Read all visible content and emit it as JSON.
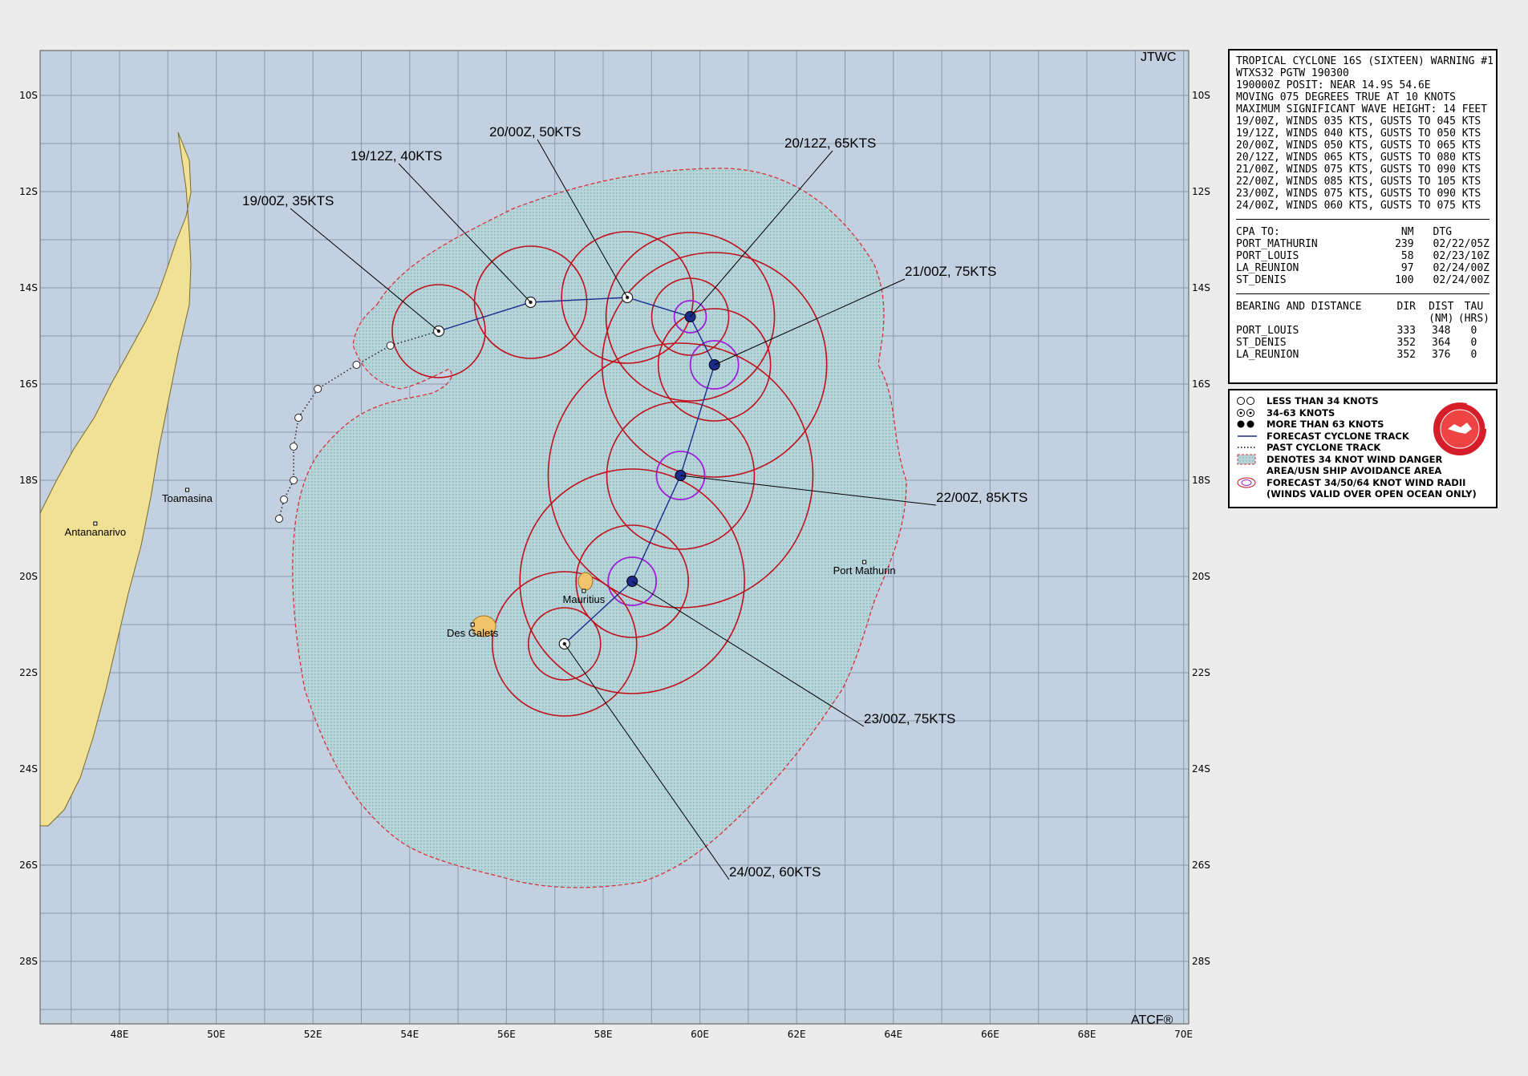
{
  "agency": "JTWC",
  "footer": "ATCF®",
  "colors": {
    "ocean": "#c2d0e0",
    "land": "#f1e194",
    "danger_area": "#aecfd6",
    "wind_radii": "#c0101b",
    "wind_radii_inner": "#a01fd8",
    "track": "#1b2a8c"
  },
  "axes": {
    "lon_labels": [
      "48E",
      "50E",
      "52E",
      "54E",
      "56E",
      "58E",
      "60E",
      "62E",
      "64E",
      "66E",
      "68E",
      "70E"
    ],
    "lat_labels": [
      "10S",
      "12S",
      "14S",
      "16S",
      "18S",
      "20S",
      "22S",
      "24S",
      "26S",
      "28S"
    ]
  },
  "places": [
    {
      "name": "Toamasina",
      "lon": 49.4,
      "lat": -18.2
    },
    {
      "name": "Antananarivo",
      "lon": 47.5,
      "lat": -18.9
    },
    {
      "name": "Mauritius",
      "lon": 57.6,
      "lat": -20.3
    },
    {
      "name": "Des Galets",
      "lon": 55.3,
      "lat": -21.0
    },
    {
      "name": "Port Mathurin",
      "lon": 63.4,
      "lat": -19.7
    }
  ],
  "forecast_labels": [
    {
      "text": "19/00Z,  35KTS"
    },
    {
      "text": "19/12Z,  40KTS"
    },
    {
      "text": "20/00Z,  50KTS"
    },
    {
      "text": "20/12Z,  65KTS"
    },
    {
      "text": "21/00Z,  75KTS"
    },
    {
      "text": "22/00Z,  85KTS"
    },
    {
      "text": "23/00Z,  75KTS"
    },
    {
      "text": "24/00Z,  60KTS"
    }
  ],
  "forecast_positions": [
    {
      "time": "19/00Z",
      "kts": 35,
      "lon": 54.6,
      "lat": -14.9
    },
    {
      "time": "19/12Z",
      "kts": 40,
      "lon": 56.5,
      "lat": -14.3
    },
    {
      "time": "20/00Z",
      "kts": 50,
      "lon": 58.5,
      "lat": -14.2
    },
    {
      "time": "20/12Z",
      "kts": 65,
      "lon": 59.8,
      "lat": -14.6
    },
    {
      "time": "21/00Z",
      "kts": 75,
      "lon": 60.3,
      "lat": -15.6
    },
    {
      "time": "22/00Z",
      "kts": 85,
      "lon": 59.6,
      "lat": -17.9
    },
    {
      "time": "23/00Z",
      "kts": 75,
      "lon": 58.6,
      "lat": -20.1
    },
    {
      "time": "24/00Z",
      "kts": 60,
      "lon": 57.2,
      "lat": -21.4
    }
  ],
  "past_track": [
    {
      "lon": 51.3,
      "lat": -18.8
    },
    {
      "lon": 51.4,
      "lat": -18.4
    },
    {
      "lon": 51.6,
      "lat": -18.0
    },
    {
      "lon": 51.6,
      "lat": -17.3
    },
    {
      "lon": 51.7,
      "lat": -16.7
    },
    {
      "lon": 52.1,
      "lat": -16.1
    },
    {
      "lon": 52.9,
      "lat": -15.6
    },
    {
      "lon": 53.6,
      "lat": -15.2
    },
    {
      "lon": 54.6,
      "lat": -14.9
    }
  ],
  "warning": {
    "lines": [
      "TROPICAL CYCLONE 16S (SIXTEEN) WARNING #1",
      "WTXS32 PGTW 190300",
      "190000Z POSIT: NEAR 14.9S 54.6E",
      "MOVING 075 DEGREES TRUE AT 10 KNOTS",
      "MAXIMUM SIGNIFICANT WAVE HEIGHT: 14 FEET",
      "19/00Z, WINDS 035 KTS, GUSTS TO 045 KTS",
      "19/12Z, WINDS 040 KTS, GUSTS TO 050 KTS",
      "20/00Z, WINDS 050 KTS, GUSTS TO 065 KTS",
      "20/12Z, WINDS 065 KTS, GUSTS TO 080 KTS",
      "21/00Z, WINDS 075 KTS, GUSTS TO 090 KTS",
      "22/00Z, WINDS 085 KTS, GUSTS TO 105 KTS",
      "23/00Z, WINDS 075 KTS, GUSTS TO 090 KTS",
      "24/00Z, WINDS 060 KTS, GUSTS TO 075 KTS"
    ],
    "cpa": {
      "headers": [
        "CPA TO:",
        "NM",
        "DTG"
      ],
      "rows": [
        [
          "PORT_MATHURIN",
          "239",
          "02/22/05Z"
        ],
        [
          "PORT_LOUIS",
          "58",
          "02/23/10Z"
        ],
        [
          "LA_REUNION",
          "97",
          "02/24/00Z"
        ],
        [
          "ST_DENIS",
          "100",
          "02/24/00Z"
        ]
      ]
    },
    "bearing": {
      "headers": [
        "BEARING AND DISTANCE",
        "DIR",
        "DIST",
        "TAU"
      ],
      "subheaders": [
        "",
        "",
        "(NM)",
        "(HRS)"
      ],
      "rows": [
        [
          "PORT_LOUIS",
          "333",
          "348",
          "0"
        ],
        [
          "ST_DENIS",
          "352",
          "364",
          "0"
        ],
        [
          "LA_REUNION",
          "352",
          "376",
          "0"
        ]
      ]
    }
  },
  "legend": [
    {
      "icon": "less-than-34-knots-icon",
      "text": "LESS THAN 34 KNOTS"
    },
    {
      "icon": "34-63-knots-icon",
      "text": "34-63 KNOTS"
    },
    {
      "icon": "more-than-63-knots-icon",
      "text": "MORE THAN 63 KNOTS"
    },
    {
      "icon": "forecast-track-icon",
      "text": "FORECAST CYCLONE TRACK"
    },
    {
      "icon": "past-track-icon",
      "text": "PAST CYCLONE TRACK"
    },
    {
      "icon": "danger-area-icon",
      "text": "DENOTES 34 KNOT WIND DANGER"
    },
    {
      "icon": "",
      "text": "AREA/USN SHIP AVOIDANCE AREA"
    },
    {
      "icon": "wind-radii-icon",
      "text": "FORECAST 34/50/64 KNOT WIND RADII"
    },
    {
      "icon": "",
      "text": "(WINDS VALID OVER OPEN OCEAN ONLY)"
    }
  ]
}
